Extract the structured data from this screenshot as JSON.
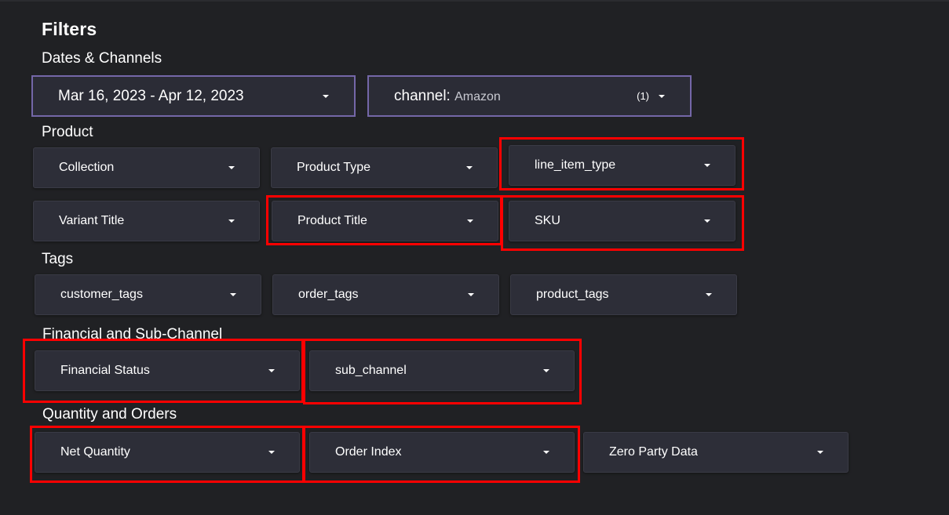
{
  "title": "Filters",
  "sections": {
    "dates_channels": "Dates & Channels",
    "product": "Product",
    "tags": "Tags",
    "financial": "Financial and Sub-Channel",
    "quantity": "Quantity and Orders"
  },
  "date_range": "Mar 16, 2023 - Apr 12, 2023",
  "channel": {
    "key": "channel:",
    "value": "Amazon",
    "count": "(1)"
  },
  "product": {
    "collection": "Collection",
    "product_type": "Product Type",
    "line_item_type": "line_item_type",
    "variant_title": "Variant Title",
    "product_title": "Product Title",
    "sku": "SKU"
  },
  "tags": {
    "customer_tags": "customer_tags",
    "order_tags": "order_tags",
    "product_tags": "product_tags"
  },
  "financial": {
    "financial_status": "Financial Status",
    "sub_channel": "sub_channel"
  },
  "quantity": {
    "net_quantity": "Net Quantity",
    "order_index": "Order Index",
    "zero_party_data": "Zero Party Data"
  },
  "colors": {
    "background": "#202124",
    "dropdown": "#2d2e38",
    "frame_accent": "#7467a8",
    "highlight": "#ff0000"
  }
}
